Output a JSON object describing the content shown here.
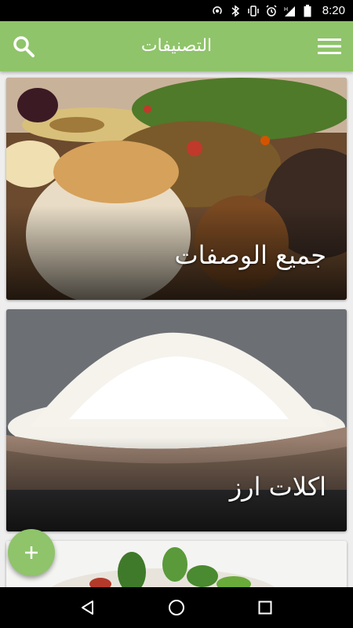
{
  "status_bar": {
    "time": "8:20",
    "icons": [
      "hotspot-icon",
      "bluetooth-icon",
      "vibrate-icon",
      "alarm-icon",
      "signal-h-icon",
      "battery-icon"
    ]
  },
  "app_bar": {
    "title": "التصنيفات",
    "left_icon": "search-icon",
    "right_icon": "menu-icon"
  },
  "categories": [
    {
      "label": "جميع الوصفات",
      "image": "mezze-platter"
    },
    {
      "label": "اكلات ارز",
      "image": "rice-bowl"
    },
    {
      "label": "",
      "image": "salad"
    }
  ],
  "fab": {
    "icon": "plus-icon",
    "color": "#8fc46a"
  },
  "nav_bar": {
    "icons": [
      "back-icon",
      "home-icon",
      "recents-icon"
    ]
  },
  "colors": {
    "primary": "#8fc46a",
    "background": "#eeeeee"
  }
}
